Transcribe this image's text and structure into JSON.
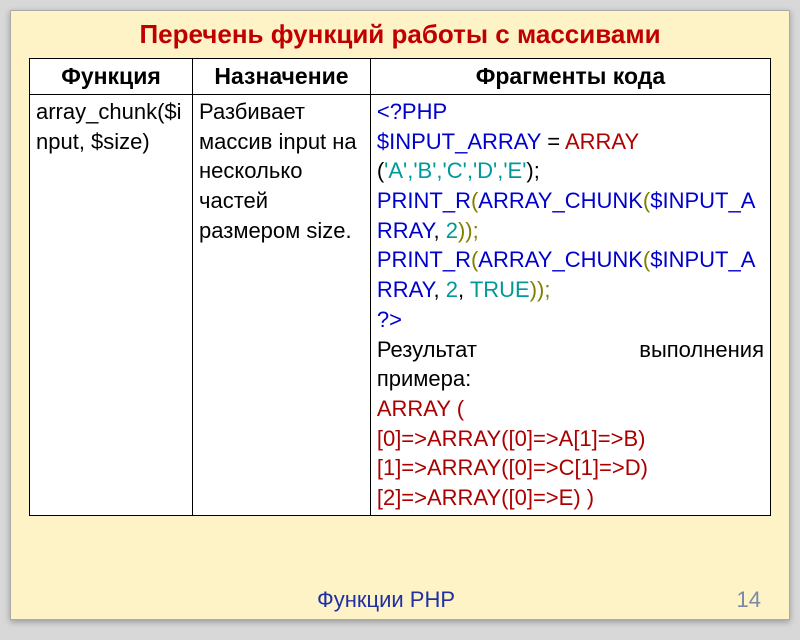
{
  "title": "Перечень функций работы с массивами",
  "headers": {
    "c1": "Функция",
    "c2": "Назначение",
    "c3": "Фрагменты кода"
  },
  "row": {
    "func": "array_chunk($input, $size)",
    "desc": "Разбивает массив input на несколько частей размером size.",
    "code": {
      "open": "<?PHP",
      "l1a": "$INPUT_ARRAY",
      "l1b": " = ",
      "l1c": "ARRAY",
      "l2a": "(",
      "l2b": "'A','B','C','D','E'",
      "l2c": ");",
      "l3a": "PRINT_R",
      "l3b": "(",
      "l3c": "ARRAY_CHUNK",
      "l3d": "(",
      "l3e": "$INPUT_ARRAY",
      "l3f": ", ",
      "l3g": "2",
      "l3h": "));",
      "l4a": "PRINT_R",
      "l4b": "(",
      "l4c": "ARRAY_CHUNK",
      "l4d": "(",
      "l4e": "$INPUT_ARRAY",
      "l4f": ", ",
      "l4g": "2",
      "l4h": ", ",
      "l4i": "TRUE",
      "l4j": "));",
      "close": "?>",
      "resLabel1": "Результат",
      "resLabel2": "выполнения",
      "resLabel3": "примера:",
      "arr": "ARRAY (",
      "r1": "[0]=>ARRAY([0]=>A[1]=>B)",
      "r2": "[1]=>ARRAY([0]=>C[1]=>D)",
      "r3": "[2]=>ARRAY([0]=>E) )"
    }
  },
  "footer": {
    "text": "Функции PHP",
    "page": "14"
  }
}
